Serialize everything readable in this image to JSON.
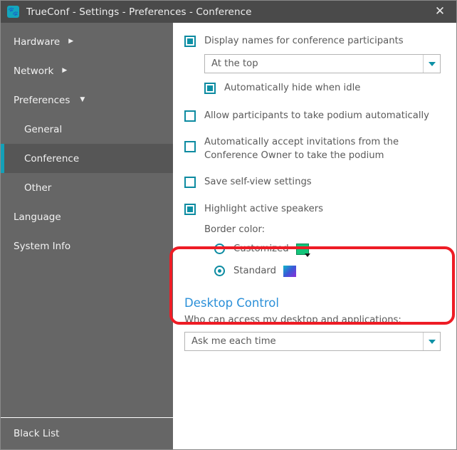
{
  "window": {
    "title": "TrueConf - Settings - Preferences - Conference",
    "app_icon": "trueconf-paw-icon",
    "close_icon": "✕",
    "accent_color": "#13a0b8",
    "titlebar_color": "#4a4a4a",
    "sidebar_color": "#666666"
  },
  "sidebar": {
    "items": [
      {
        "label": "Hardware",
        "arrow": "▶",
        "level": 0,
        "selected": false
      },
      {
        "label": "Network",
        "arrow": "▶",
        "level": 0,
        "selected": false
      },
      {
        "label": "Preferences",
        "arrow": "▼",
        "level": 0,
        "selected": false
      },
      {
        "label": "General",
        "arrow": "",
        "level": 1,
        "selected": false
      },
      {
        "label": "Conference",
        "arrow": "",
        "level": 1,
        "selected": true
      },
      {
        "label": "Other",
        "arrow": "",
        "level": 1,
        "selected": false
      },
      {
        "label": "Language",
        "arrow": "",
        "level": 0,
        "selected": false
      },
      {
        "label": "System Info",
        "arrow": "",
        "level": 0,
        "selected": false
      }
    ],
    "footer": {
      "label": "Black List"
    }
  },
  "main": {
    "display_names": {
      "label": "Display names for conference participants",
      "checked": true
    },
    "position_dropdown": {
      "value": "At the top",
      "arrow_icon": "chevron-down-icon"
    },
    "auto_hide": {
      "label": "Automatically hide when idle",
      "checked": true
    },
    "allow_podium": {
      "label": "Allow participants to take podium automatically",
      "checked": false
    },
    "auto_accept": {
      "label": "Automatically accept invitations from the Conference Owner to take the podium",
      "checked": false
    },
    "save_selfview": {
      "label": "Save self-view settings",
      "checked": false
    },
    "highlight_speakers": {
      "label": "Highlight active speakers",
      "checked": true
    },
    "border_color_label": "Border color:",
    "border_color_options": [
      {
        "label": "Customized",
        "selected": false,
        "swatch": "#14c47a"
      },
      {
        "label": "Standard",
        "selected": true,
        "swatch": "#8a2fd8"
      }
    ],
    "desktop_control": {
      "title": "Desktop Control",
      "description": "Who can access my desktop and applications:",
      "dropdown_value": "Ask me each time",
      "arrow_icon": "chevron-down-icon",
      "highlight_color": "#ee1c25"
    }
  }
}
